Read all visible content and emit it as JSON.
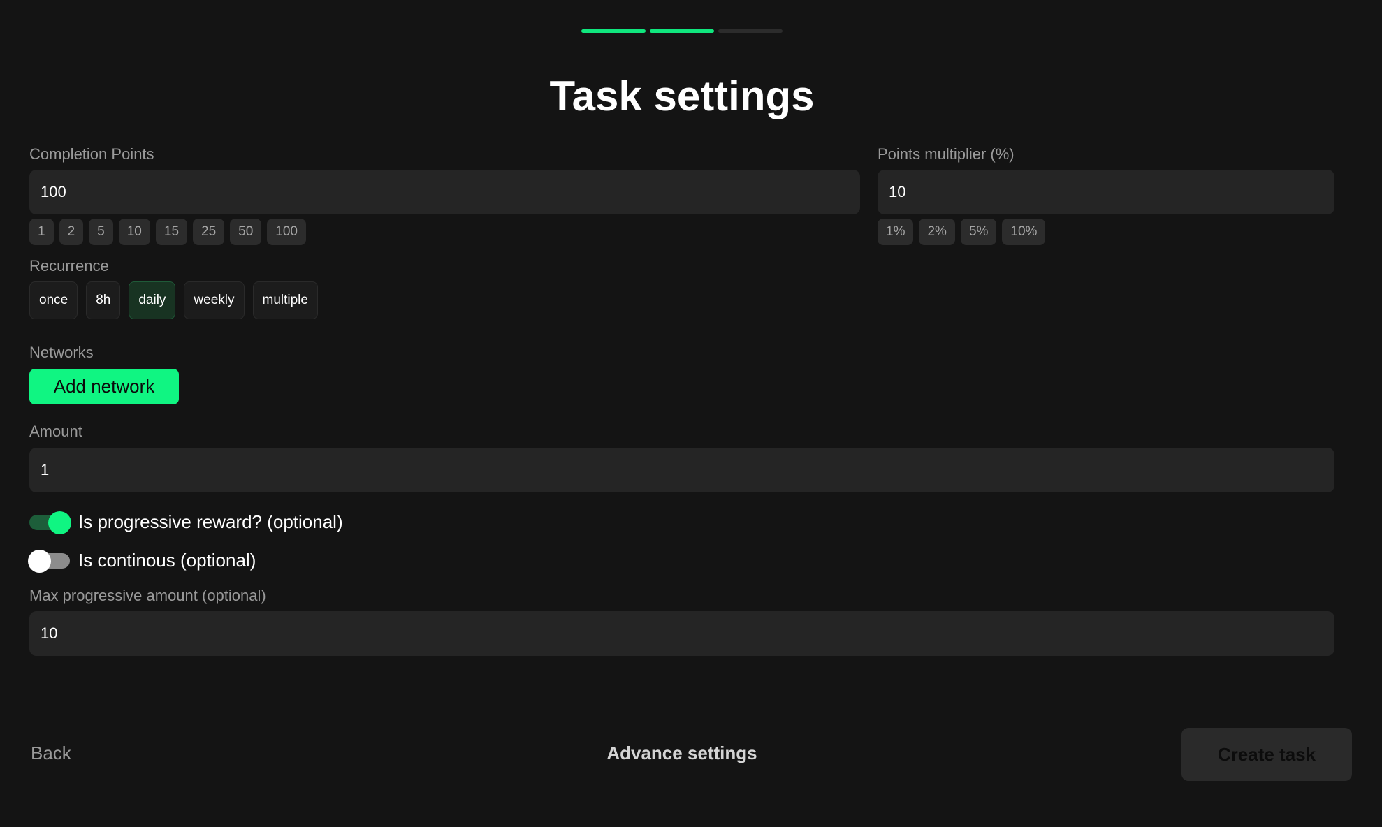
{
  "stepper": {
    "steps": [
      {
        "state": "done"
      },
      {
        "state": "done"
      },
      {
        "state": "pending"
      }
    ]
  },
  "page_title": "Task settings",
  "completion_points": {
    "label": "Completion Points",
    "value": "100",
    "presets": [
      "1",
      "2",
      "5",
      "10",
      "15",
      "25",
      "50",
      "100"
    ]
  },
  "points_multiplier": {
    "label": "Points multiplier (%)",
    "value": "10",
    "presets": [
      "1%",
      "2%",
      "5%",
      "10%"
    ]
  },
  "recurrence": {
    "label": "Recurrence",
    "options": [
      "once",
      "8h",
      "daily",
      "weekly",
      "multiple"
    ],
    "selected": "daily"
  },
  "networks": {
    "label": "Networks",
    "add_label": "Add network"
  },
  "amount": {
    "label": "Amount",
    "value": "1"
  },
  "progressive_reward": {
    "label": "Is progressive reward? (optional)",
    "on": true
  },
  "continuous": {
    "label": "Is continous (optional)",
    "on": false
  },
  "max_progressive": {
    "label": "Max progressive amount (optional)",
    "value": "10"
  },
  "footer": {
    "back_label": "Back",
    "advance_label": "Advance settings",
    "create_label": "Create task"
  },
  "colors": {
    "accent": "#10f582",
    "background": "#141414",
    "input_bg": "#252525",
    "selected_bg": "#183322"
  }
}
